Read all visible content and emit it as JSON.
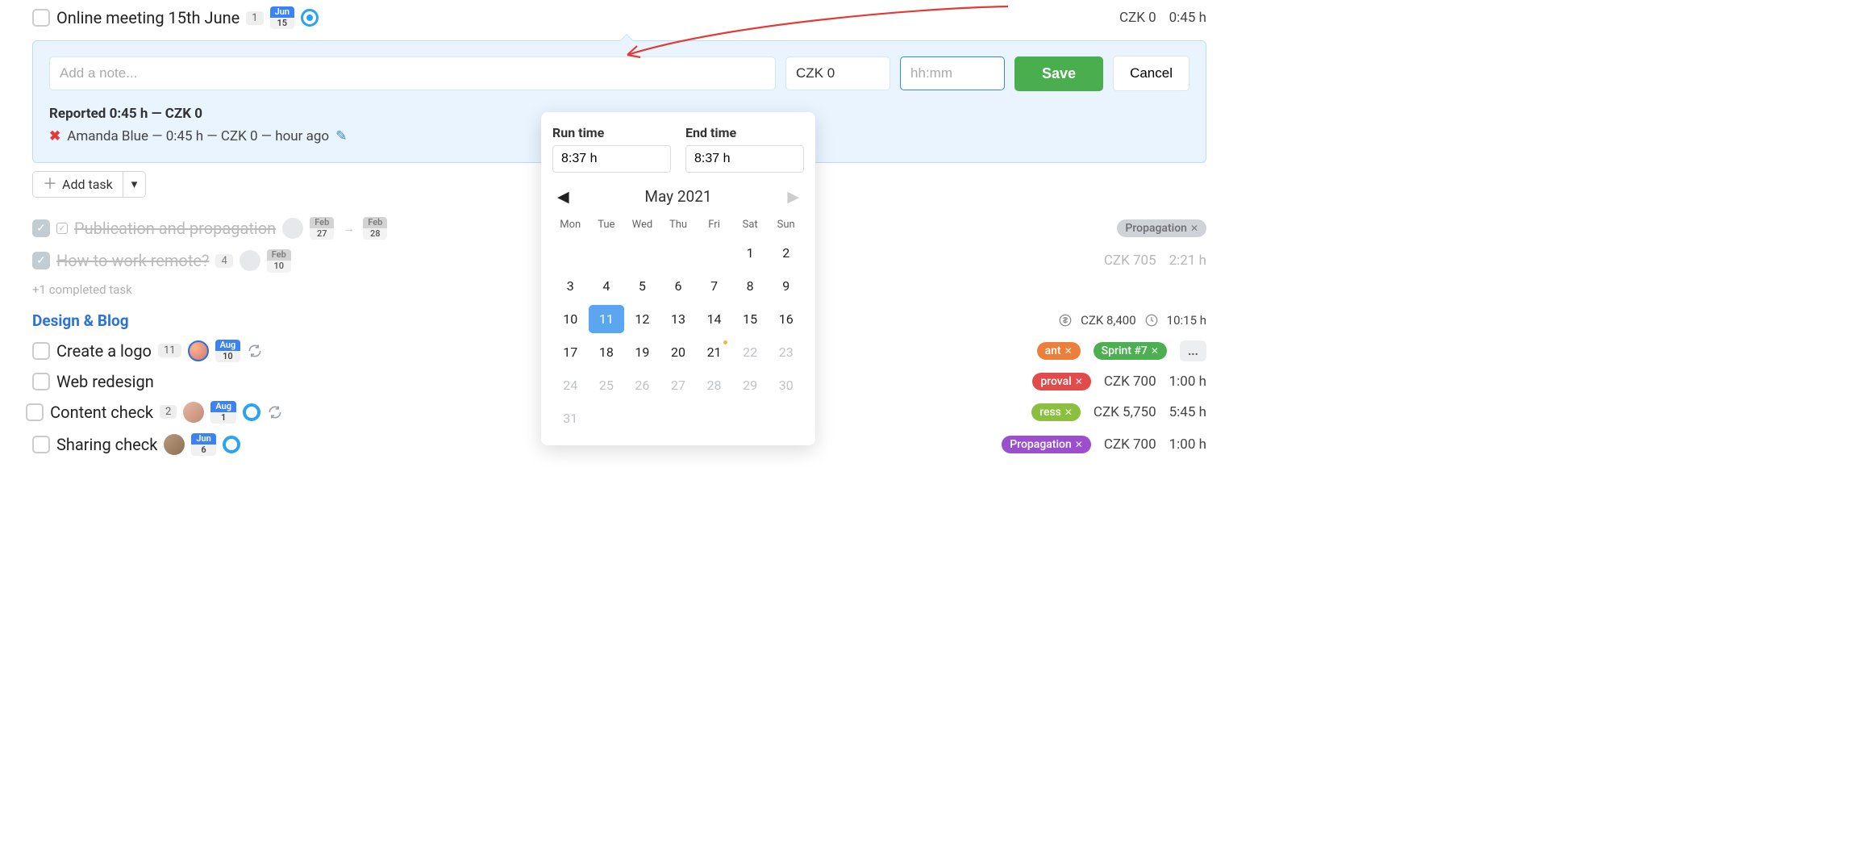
{
  "header_task": {
    "title": "Online meeting 15th June",
    "count": "1",
    "date_month": "Jun",
    "date_day": "15",
    "price": "CZK 0",
    "hours": "0:45 h"
  },
  "note_panel": {
    "note_placeholder": "Add a note...",
    "czk_value": "CZK 0",
    "hhmm_placeholder": "hh:mm",
    "save_label": "Save",
    "cancel_label": "Cancel",
    "reported_title": "Reported 0:45 h — CZK 0",
    "reported_line": "Amanda Blue — 0:45 h — CZK 0 — hour ago"
  },
  "add_task_label": "Add task",
  "completed_tasks": [
    {
      "title": "Publication and propagation",
      "date1_m": "Feb",
      "date1_d": "27",
      "date2_m": "Feb",
      "date2_d": "28",
      "tag": "Propagation"
    },
    {
      "title": "How to work remote?",
      "count": "4",
      "date_m": "Feb",
      "date_d": "10",
      "price": "CZK 705",
      "hours": "2:21 h"
    }
  ],
  "more_completed": "+1 completed task",
  "section": {
    "title": "Design & Blog",
    "price": "CZK 8,400",
    "hours": "10:15 h"
  },
  "tasks": [
    {
      "title": "Create a logo",
      "count": "11",
      "date_m": "Aug",
      "date_d": "10",
      "avatar": "a1",
      "tags": [
        {
          "text": "ant",
          "cls": "orange"
        },
        {
          "text": "Sprint #7",
          "cls": "green"
        }
      ],
      "more": "...",
      "refresh": true,
      "ring": false
    },
    {
      "title": "Web redesign",
      "tags": [
        {
          "text": "proval",
          "cls": "red"
        }
      ],
      "price": "CZK 700",
      "hours": "1:00 h"
    },
    {
      "title": "Content check",
      "count": "2",
      "date_m": "Aug",
      "date_d": "1",
      "avatar": "a2",
      "ring": true,
      "refresh": true,
      "warn": true,
      "tags": [
        {
          "text": "ress",
          "cls": "lime"
        }
      ],
      "price": "CZK 5,750",
      "hours": "5:45 h"
    },
    {
      "title": "Sharing check",
      "date_m": "Jun",
      "date_d": "6",
      "avatar": "a3",
      "ring": true,
      "tags": [
        {
          "text": "Propagation",
          "cls": "purple"
        }
      ],
      "price": "CZK 700",
      "hours": "1:00 h"
    }
  ],
  "datepicker": {
    "run_time_label": "Run time",
    "end_time_label": "End time",
    "run_time_value": "8:37 h",
    "end_time_value": "8:37 h",
    "month": "May 2021",
    "dow": [
      "Mon",
      "Tue",
      "Wed",
      "Thu",
      "Fri",
      "Sat",
      "Sun"
    ],
    "days": [
      {
        "t": "",
        "muted": true
      },
      {
        "t": "",
        "muted": true
      },
      {
        "t": "",
        "muted": true
      },
      {
        "t": "",
        "muted": true
      },
      {
        "t": "",
        "muted": true
      },
      {
        "t": "1"
      },
      {
        "t": "2"
      },
      {
        "t": "3"
      },
      {
        "t": "4"
      },
      {
        "t": "5"
      },
      {
        "t": "6"
      },
      {
        "t": "7"
      },
      {
        "t": "8"
      },
      {
        "t": "9"
      },
      {
        "t": "10"
      },
      {
        "t": "11",
        "selected": true
      },
      {
        "t": "12"
      },
      {
        "t": "13"
      },
      {
        "t": "14"
      },
      {
        "t": "15"
      },
      {
        "t": "16"
      },
      {
        "t": "17"
      },
      {
        "t": "18"
      },
      {
        "t": "19"
      },
      {
        "t": "20"
      },
      {
        "t": "21",
        "dot": true
      },
      {
        "t": "22",
        "muted": true
      },
      {
        "t": "23",
        "muted": true
      },
      {
        "t": "24",
        "muted": true
      },
      {
        "t": "25",
        "muted": true
      },
      {
        "t": "26",
        "muted": true
      },
      {
        "t": "27",
        "muted": true
      },
      {
        "t": "28",
        "muted": true
      },
      {
        "t": "29",
        "muted": true
      },
      {
        "t": "30",
        "muted": true
      },
      {
        "t": "31",
        "muted": true
      }
    ]
  }
}
